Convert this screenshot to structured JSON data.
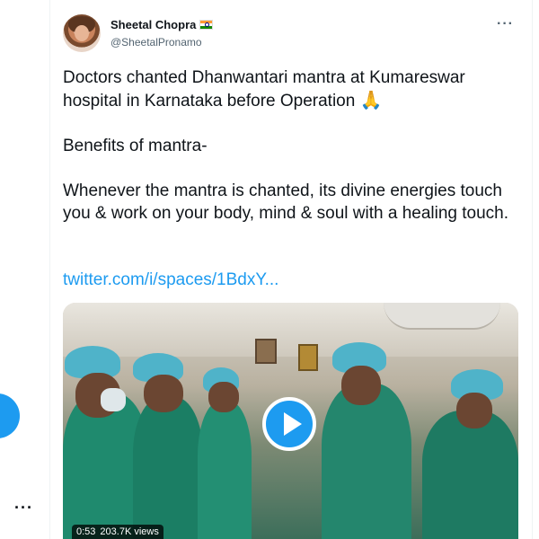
{
  "sidebar": {
    "more_label": "···"
  },
  "tweet": {
    "author": {
      "name": "Sheetal Chopra",
      "flag_icon": "india-flag-icon",
      "handle": "@SheetalPronamo"
    },
    "menu_label": "···",
    "text": {
      "paragraph1": "Doctors chanted Dhanwantari mantra at Kumareswar hospital in Karnataka before Operation",
      "emoji": "🙏",
      "paragraph2": "Benefits of mantra-",
      "paragraph3": "Whenever the mantra is chanted, its divine energies touch you & work on your body, mind & soul with a healing touch."
    },
    "link": "twitter.com/i/spaces/1BdxY...",
    "media": {
      "duration": "0:53",
      "views": "203.7K views"
    }
  },
  "colors": {
    "accent": "#1d9bf0",
    "text": "#0f1419",
    "muted": "#536471"
  }
}
